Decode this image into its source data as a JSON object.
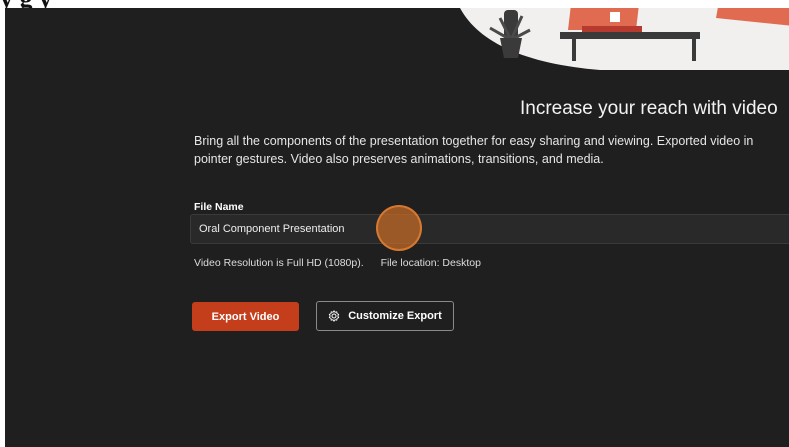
{
  "overlay": {
    "text": "y                           g y"
  },
  "dialog": {
    "headline": "Increase your reach with video",
    "description_line1": "Bring all the components of the presentation together for easy sharing and viewing. Exported video in",
    "description_line2": "pointer gestures. Video also preserves animations, transitions, and media.",
    "file_name_label": "File Name",
    "file_name_value": "Oral Component Presentation",
    "resolution_text": "Video Resolution is Full HD (1080p).",
    "location_text": "File location: Desktop",
    "export_button": "Export Video",
    "customize_button": "Customize Export"
  },
  "icons": {
    "customize": "gear-icon"
  },
  "colors": {
    "background": "#1f1f1f",
    "accent": "#c43e1c",
    "cursor_highlight": "#cd6e28"
  }
}
